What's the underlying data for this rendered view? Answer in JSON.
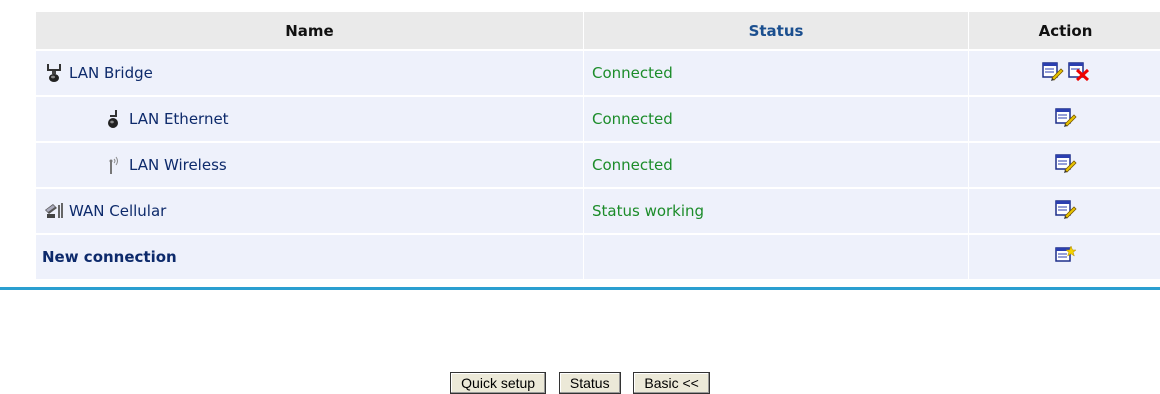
{
  "table": {
    "headers": {
      "name": "Name",
      "status": "Status",
      "action": "Action"
    },
    "rows": [
      {
        "name": "LAN Bridge",
        "status": "Connected",
        "icon": "bridge-icon"
      },
      {
        "name": "LAN Ethernet",
        "status": "Connected",
        "icon": "ethernet-plug-icon"
      },
      {
        "name": "LAN Wireless",
        "status": "Connected",
        "icon": "wireless-antenna-icon"
      },
      {
        "name": "WAN Cellular",
        "status": "Status working",
        "icon": "cellular-modem-icon"
      }
    ],
    "new_connection": "New connection"
  },
  "buttons": {
    "quick_setup": "Quick setup",
    "status": "Status",
    "basic": "Basic <<"
  },
  "colors": {
    "accent_line": "#2a9fd0",
    "status_text": "#1c8c2a",
    "row_bg": "#eef1fb",
    "header_bg": "#eaeaea"
  }
}
